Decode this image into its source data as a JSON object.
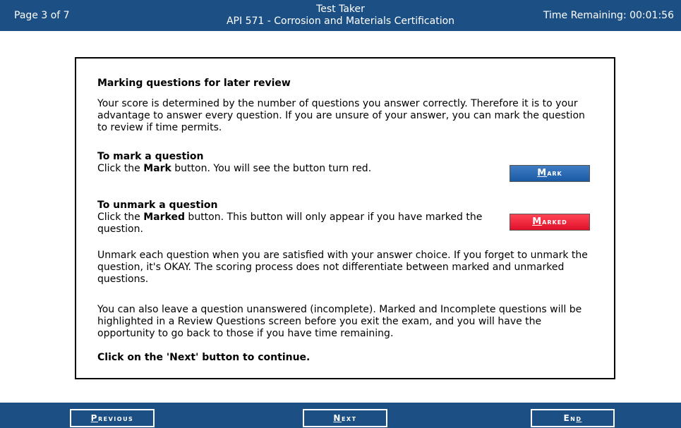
{
  "header": {
    "page_indicator": "Page 3 of 7",
    "user": "Test Taker",
    "exam_title": "API 571 - Corrosion and Materials Certification",
    "timer": "Time Remaining: 00:01:56"
  },
  "content": {
    "heading": "Marking questions for later review",
    "intro": "Your score is determined by the number of questions you answer correctly. Therefore it is to your advantage to answer every question. If you are unsure of your answer, you can mark the question to review if time permits.",
    "mark_title": "To mark a question",
    "mark_text_pre": "Click the ",
    "mark_text_bold": "Mark",
    "mark_text_post": " button. You will see the button turn red.",
    "unmark_title": "To unmark a question",
    "unmark_text_pre": "Click the ",
    "unmark_text_bold": "Marked",
    "unmark_text_post": " button. This button will only appear if you have marked the question.",
    "para_unmark": "Unmark each question when you are satisfied with your answer choice. If you forget to unmark the question, it's OKAY. The scoring process does not differentiate between marked and unmarked questions.",
    "para_incomplete": "You can also leave a question unanswered (incomplete). Marked and Incomplete questions will be highlighted in a Review Questions screen before you exit the exam, and you will have the opportunity to go back to those if you have time remaining.",
    "final_instruction": "Click on the 'Next' button to continue.",
    "mark_button_first": "M",
    "mark_button_rest": "ark",
    "marked_button_first": "M",
    "marked_button_rest": "arked"
  },
  "footer": {
    "previous_first": "P",
    "previous_rest": "revious",
    "next_first": "N",
    "next_rest": "ext",
    "end_pre": "En",
    "end_underlined": "d"
  },
  "colors": {
    "bar": "#1c4f83",
    "mark_button": "#1a5aa5",
    "marked_button": "#e0102a"
  }
}
